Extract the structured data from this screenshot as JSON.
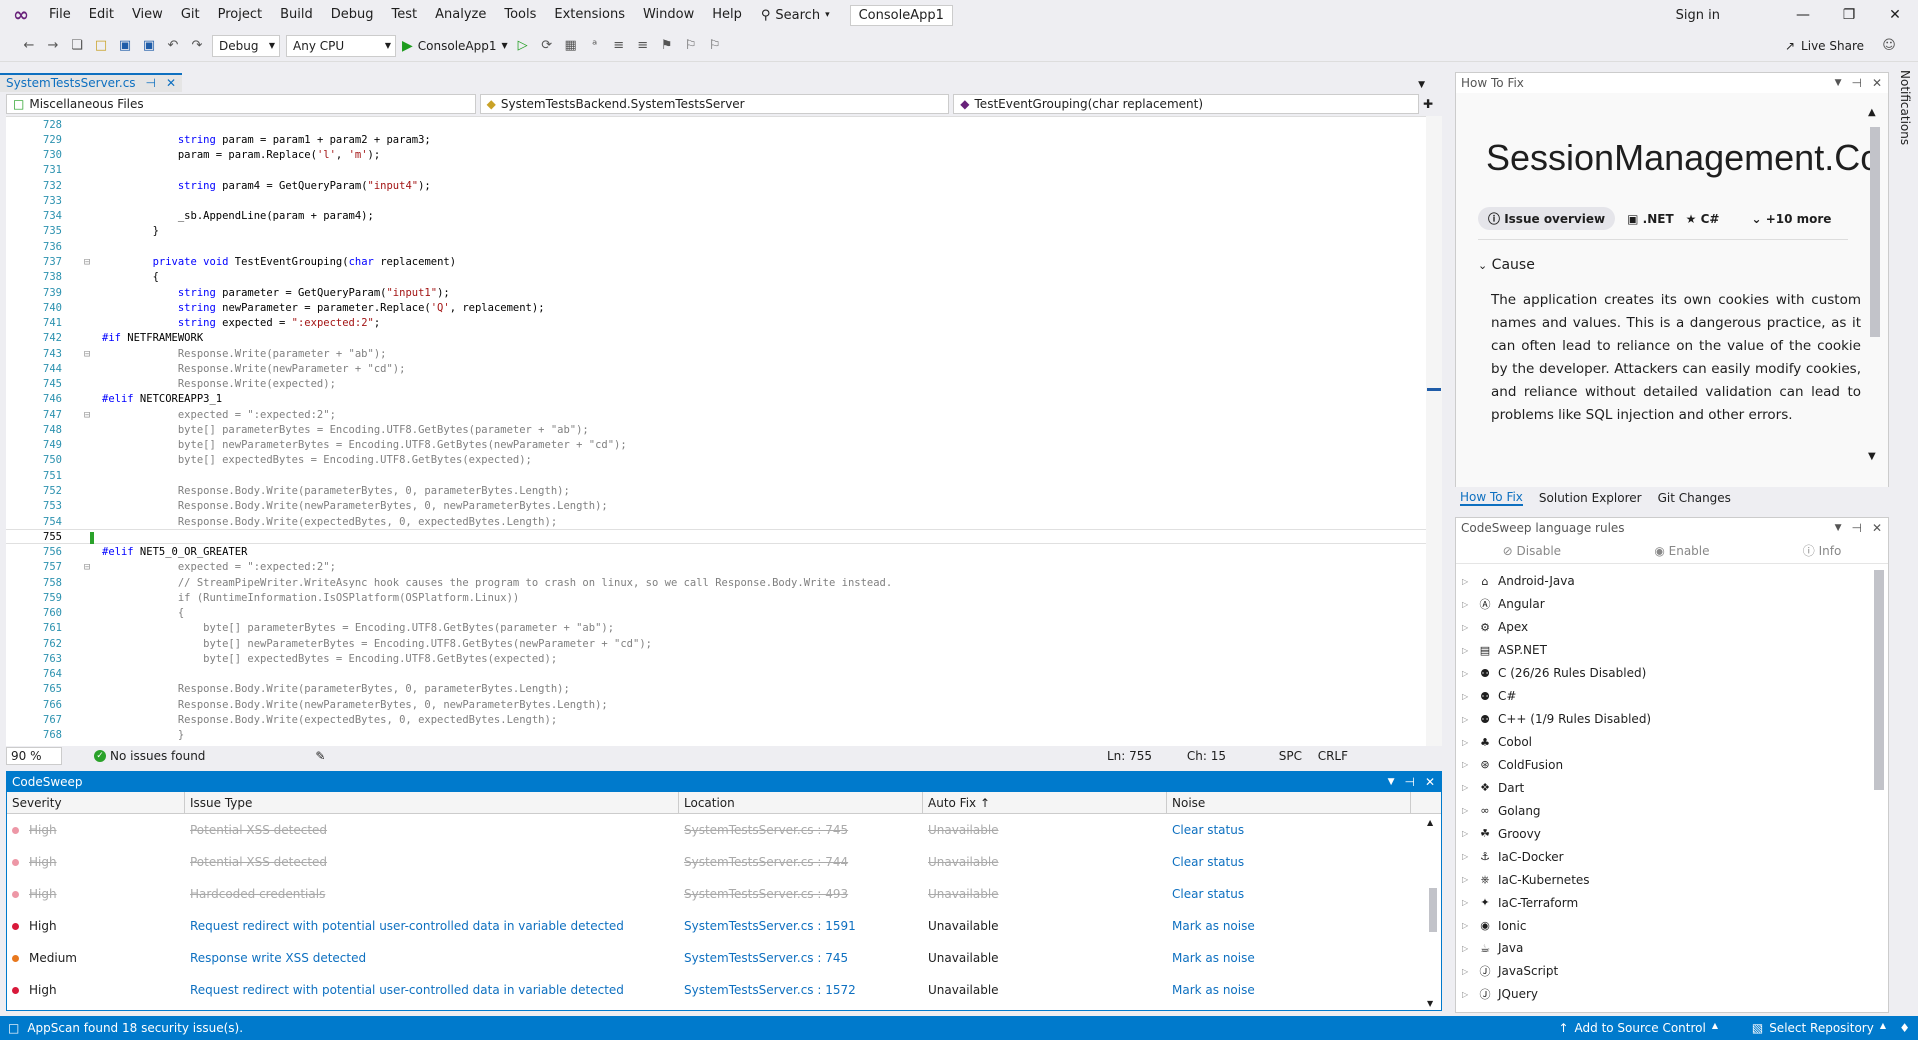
{
  "menu": {
    "items": [
      "File",
      "Edit",
      "View",
      "Git",
      "Project",
      "Build",
      "Debug",
      "Test",
      "Analyze",
      "Tools",
      "Extensions",
      "Window",
      "Help"
    ],
    "search_label": "Search",
    "solution_name": "ConsoleApp1",
    "sign_in": "Sign in"
  },
  "toolbar": {
    "config": "Debug",
    "platform": "Any CPU",
    "run_target": "ConsoleApp1",
    "live_share": "Live Share"
  },
  "editor": {
    "tab_name": "SystemTestsServer.cs",
    "nav_project": "Miscellaneous Files",
    "nav_class": "SystemTestsBackend.SystemTestsServer",
    "nav_member": "TestEventGrouping(char replacement)",
    "zoom": "90 %",
    "issues": "No issues found",
    "ln": "Ln: 755",
    "ch": "Ch: 15",
    "spc": "SPC",
    "crlf": "CRLF",
    "lines": [
      {
        "n": "728",
        "t": ""
      },
      {
        "n": "729",
        "t": "            string param = param1 + param2 + param3;"
      },
      {
        "n": "730",
        "t": "            param = param.Replace('l', 'm');"
      },
      {
        "n": "731",
        "t": ""
      },
      {
        "n": "732",
        "t": "            string param4 = GetQueryParam(\"input4\");"
      },
      {
        "n": "733",
        "t": ""
      },
      {
        "n": "734",
        "t": "            _sb.AppendLine(param + param4);"
      },
      {
        "n": "735",
        "t": "        }"
      },
      {
        "n": "736",
        "t": ""
      },
      {
        "n": "737",
        "t": "        private void TestEventGrouping(char replacement)"
      },
      {
        "n": "738",
        "t": "        {"
      },
      {
        "n": "739",
        "t": "            string parameter = GetQueryParam(\"input1\");"
      },
      {
        "n": "740",
        "t": "            string newParameter = parameter.Replace('Q', replacement);"
      },
      {
        "n": "741",
        "t": "            string expected = \":expected:2\";"
      },
      {
        "n": "742",
        "t": "#if NETFRAMEWORK"
      },
      {
        "n": "743",
        "t": "            Response.Write(parameter + \"ab\");"
      },
      {
        "n": "744",
        "t": "            Response.Write(newParameter + \"cd\");"
      },
      {
        "n": "745",
        "t": "            Response.Write(expected);"
      },
      {
        "n": "746",
        "t": "#elif NETCOREAPP3_1"
      },
      {
        "n": "747",
        "t": "            expected = \":expected:2\";"
      },
      {
        "n": "748",
        "t": "            byte[] parameterBytes = Encoding.UTF8.GetBytes(parameter + \"ab\");"
      },
      {
        "n": "749",
        "t": "            byte[] newParameterBytes = Encoding.UTF8.GetBytes(newParameter + \"cd\");"
      },
      {
        "n": "750",
        "t": "            byte[] expectedBytes = Encoding.UTF8.GetBytes(expected);"
      },
      {
        "n": "751",
        "t": ""
      },
      {
        "n": "752",
        "t": "            Response.Body.Write(parameterBytes, 0, parameterBytes.Length);"
      },
      {
        "n": "753",
        "t": "            Response.Body.Write(newParameterBytes, 0, newParameterBytes.Length);"
      },
      {
        "n": "754",
        "t": "            Response.Body.Write(expectedBytes, 0, expectedBytes.Length);"
      },
      {
        "n": "755",
        "t": ""
      },
      {
        "n": "756",
        "t": "#elif NET5_0_OR_GREATER"
      },
      {
        "n": "757",
        "t": "            expected = \":expected:2\";"
      },
      {
        "n": "758",
        "t": "            // StreamPipeWriter.WriteAsync hook causes the program to crash on linux, so we call Response.Body.Write instead."
      },
      {
        "n": "759",
        "t": "            if (RuntimeInformation.IsOSPlatform(OSPlatform.Linux))"
      },
      {
        "n": "760",
        "t": "            {"
      },
      {
        "n": "761",
        "t": "                byte[] parameterBytes = Encoding.UTF8.GetBytes(parameter + \"ab\");"
      },
      {
        "n": "762",
        "t": "                byte[] newParameterBytes = Encoding.UTF8.GetBytes(newParameter + \"cd\");"
      },
      {
        "n": "763",
        "t": "                byte[] expectedBytes = Encoding.UTF8.GetBytes(expected);"
      },
      {
        "n": "764",
        "t": ""
      },
      {
        "n": "765",
        "t": "            Response.Body.Write(parameterBytes, 0, parameterBytes.Length);"
      },
      {
        "n": "766",
        "t": "            Response.Body.Write(newParameterBytes, 0, newParameterBytes.Length);"
      },
      {
        "n": "767",
        "t": "            Response.Body.Write(expectedBytes, 0, expectedBytes.Length);"
      },
      {
        "n": "768",
        "t": "            }"
      }
    ]
  },
  "codesweep": {
    "title": "CodeSweep",
    "headers": [
      "Severity",
      "Issue Type",
      "Location",
      "Auto Fix ↑",
      "Noise"
    ],
    "rows": [
      {
        "sev": "High",
        "type": "Potential XSS detected",
        "loc": "SystemTestsServer.cs : 745",
        "fix": "Unavailable",
        "noise": "Clear status",
        "resolved": true
      },
      {
        "sev": "High",
        "type": "Potential XSS detected",
        "loc": "SystemTestsServer.cs : 744",
        "fix": "Unavailable",
        "noise": "Clear status",
        "resolved": true
      },
      {
        "sev": "High",
        "type": "Hardcoded credentials",
        "loc": "SystemTestsServer.cs : 493",
        "fix": "Unavailable",
        "noise": "Clear status",
        "resolved": true
      },
      {
        "sev": "High",
        "type": "Request redirect with potential user-controlled data in variable detected",
        "loc": "SystemTestsServer.cs : 1591",
        "fix": "Unavailable",
        "noise": "Mark as noise",
        "resolved": false
      },
      {
        "sev": "Medium",
        "type": "Response write XSS detected",
        "loc": "SystemTestsServer.cs : 745",
        "fix": "Unavailable",
        "noise": "Mark as noise",
        "resolved": false
      },
      {
        "sev": "High",
        "type": "Request redirect with potential user-controlled data in variable detected",
        "loc": "SystemTestsServer.cs : 1572",
        "fix": "Unavailable",
        "noise": "Mark as noise",
        "resolved": false
      }
    ]
  },
  "status_bar": {
    "message": "AppScan found 18 security issue(s).",
    "add_source": "Add to Source Control",
    "select_repo": "Select Repository"
  },
  "howto": {
    "title": "How To Fix",
    "heading": "SessionManagement.Co",
    "chips": [
      "Issue overview",
      ".NET",
      "C#",
      "+10 more"
    ],
    "cause_label": "Cause",
    "cause_text": "The application creates its own cookies with custom names and values. This is a dangerous practice, as it can often lead to reliance on the value of the cookie by the developer. Attackers can easily modify cookies, and reliance without detailed validation can lead to problems like SQL injection and other errors."
  },
  "bottom_tabs": [
    "How To Fix",
    "Solution Explorer",
    "Git Changes"
  ],
  "rules": {
    "title": "CodeSweep language rules",
    "actions": [
      "Disable",
      "Enable",
      "Info"
    ],
    "items": [
      "Android-Java",
      "Angular",
      "Apex",
      "ASP.NET",
      "C (26/26 Rules Disabled)",
      "C#",
      "C++ (1/9 Rules Disabled)",
      "Cobol",
      "ColdFusion",
      "Dart",
      "Golang",
      "Groovy",
      "IaC-Docker",
      "IaC-Kubernetes",
      "IaC-Terraform",
      "Ionic",
      "Java",
      "JavaScript",
      "JQuery"
    ]
  },
  "notifications": "Notifications",
  "colors": {
    "accent": "#007acc",
    "high": "#d8193a",
    "medium": "#e8781e",
    "link": "#0e70c0"
  }
}
